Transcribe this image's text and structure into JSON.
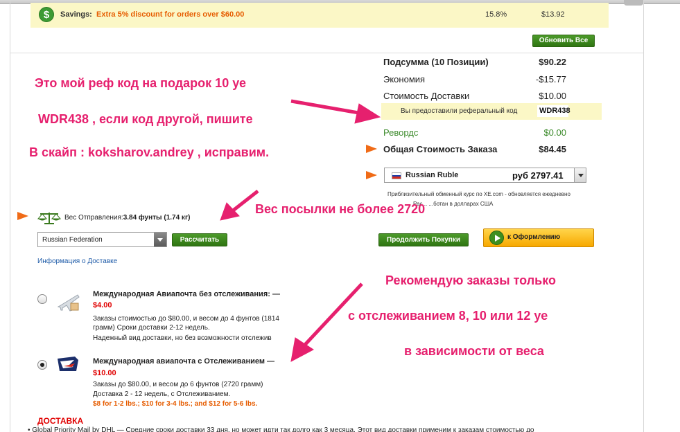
{
  "savings": {
    "icon": "dollar-icon",
    "symbol": "$",
    "label": "Savings:",
    "text": "Extra 5% discount for orders over $60.00",
    "percent": "15.8%",
    "amount": "$13.92"
  },
  "update_button": "Обновить Все",
  "summary": {
    "subtotal_label": "Подсумма (10 Позиции)",
    "subtotal_value": "$90.22",
    "savings_label": "Экономия",
    "savings_value": "-$15.77",
    "shipping_label": "Стоимость Доставки",
    "shipping_value": "$10.00",
    "referral_label": "Вы предоставили реферальный код",
    "referral_code": "WDR438",
    "rewards_label": "Ревордс",
    "rewards_value": "$0.00",
    "total_label": "Общая Стоимость Заказа",
    "total_value": "$84.45"
  },
  "currency": {
    "name": "Russian Ruble",
    "value": "руб 2797.41",
    "flag_colors": [
      "#ffffff",
      "#1c3faa",
      "#d52b1e"
    ],
    "note1": "Приблизительный обменный курс по XE.com - обновляется ежедневно",
    "note2": "Рас...        ...ботан в долларах США"
  },
  "weight": {
    "icon": "scale-icon",
    "label": "Вес Отправления:",
    "value": "3.84 фунты (1.74 кг)"
  },
  "country": "Russian Federation",
  "buttons": {
    "calculate": "Рассчитать",
    "continue": "Продолжить Покупки",
    "checkout": "к Оформлению"
  },
  "delivery_link": "Информация о Доставке",
  "shipping_options": [
    {
      "icon": "airplane-icon",
      "title": "Международная Авиапочта без отслеживания: —",
      "price": "$4.00",
      "desc1": "Заказы стоимостью до $80.00, и весом до 4 фунтов (1814",
      "desc2": "грамм) Сроки доставки 2-12 недель.",
      "desc3": "Надежный вид доставки, но без возможности отслежив",
      "selected": false
    },
    {
      "icon": "usps-eagle-icon",
      "title": "Международная авиапочта с Отслеживанием —",
      "price": "$10.00",
      "desc1": "Заказы до $80.00, и весом до 6 фунтов (2720 грамм)",
      "desc2": "Доставка 2 - 12 недель, с Отслеживанием.",
      "desc3": "$8 for 1-2 lbs.; $10 for 3-4 lbs.; and $12 for 5-6 lbs.",
      "selected": true
    }
  ],
  "dostavka_heading": "ДОСТАВКА",
  "bottom_text": "• Global Priority Mail by DHL — Средние сроки доставки 33 дня, но может идти так долго как 3 месяца. Этот вид доставки применим к заказам стоимостью до",
  "annotations": {
    "line1": "Это мой реф код на подарок 10 уе",
    "line2": "WDR438 , если код другой, пишите",
    "line3": "В скайп : koksharov.andrey , исправим.",
    "weight_note": "Вес посылки не более 2720",
    "rec1": "Рекомендую заказы только",
    "rec2": "с отслеживанием 8, 10 или 12 уе",
    "rec3": "в зависимости от веса"
  },
  "colors": {
    "annotation": "#e6206e",
    "accent_orange": "#f06b17",
    "button_green": "#3b8a2a",
    "price_red": "#e00000",
    "highlight_yellow": "#fbf7c6"
  }
}
